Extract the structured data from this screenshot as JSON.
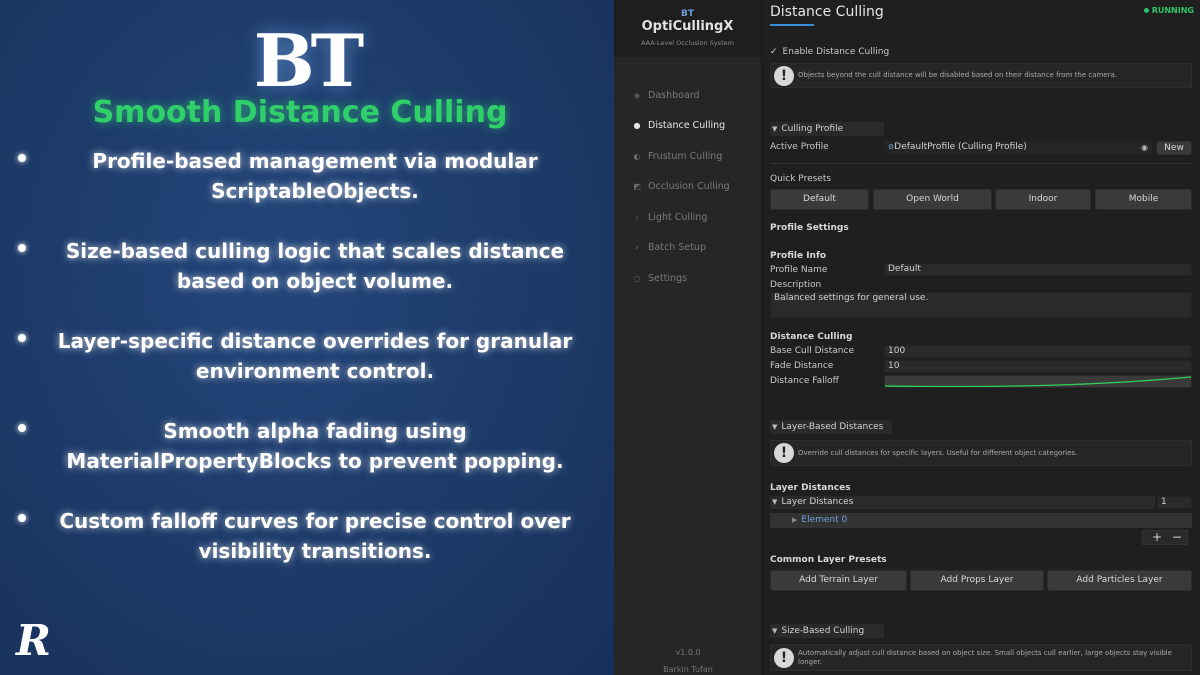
{
  "promo": {
    "logo_text": "BT",
    "title": "Smooth Distance Culling",
    "bullets": [
      "Profile-based management via modular ScriptableObjects.",
      "Size-based culling logic that scales distance based on object volume.",
      "Layer-specific distance overrides for granular environment control.",
      "Smooth alpha fading using MaterialPropertyBlocks to prevent popping.",
      "Custom falloff curves for precise control over visibility transitions."
    ],
    "corner_logo": "R"
  },
  "sidebar": {
    "brand_small": "BT",
    "brand_name": "OptiCullingX",
    "brand_sub": "AAA-Level Occlusion System",
    "items": [
      {
        "label": "Dashboard",
        "icon": "diamond-icon"
      },
      {
        "label": "Distance Culling",
        "icon": "circle-icon"
      },
      {
        "label": "Frustum Culling",
        "icon": "half-circle-icon"
      },
      {
        "label": "Occlusion Culling",
        "icon": "wedge-icon"
      },
      {
        "label": "Light Culling",
        "icon": "chevron-icon"
      },
      {
        "label": "Batch Setup",
        "icon": "chevron-icon"
      },
      {
        "label": "Settings",
        "icon": "gear-icon"
      }
    ],
    "active_index": 1,
    "version": "v1.0.0",
    "author": "Barkin Tufan"
  },
  "main": {
    "title": "Distance Culling",
    "status": "RUNNING",
    "enable_label": "Enable Distance Culling",
    "enable_checked": true,
    "enable_help": "Objects beyond the cull distance will be disabled based on their distance from the camera.",
    "culling_profile_header": "Culling Profile",
    "active_profile_label": "Active Profile",
    "active_profile_value": "DefaultProfile (Culling Profile)",
    "new_button": "New",
    "quick_presets_label": "Quick Presets",
    "presets": [
      "Default",
      "Open World",
      "Indoor",
      "Mobile"
    ],
    "profile_settings_label": "Profile Settings",
    "profile_info_label": "Profile Info",
    "profile_name_label": "Profile Name",
    "profile_name_value": "Default",
    "description_label": "Description",
    "description_value": "Balanced settings for general use.",
    "distance_culling_label": "Distance Culling",
    "base_cull_label": "Base Cull Distance",
    "base_cull_value": "100",
    "fade_label": "Fade Distance",
    "fade_value": "10",
    "falloff_label": "Distance Falloff",
    "layer_header": "Layer-Based Distances",
    "layer_help": "Override cull distances for specific layers. Useful for different object categories.",
    "layer_distances_label": "Layer Distances",
    "layer_distances_foldout": "Layer Distances",
    "layer_count": "1",
    "element_label": "Element 0",
    "plus": "+",
    "minus": "−",
    "common_presets_label": "Common Layer Presets",
    "layer_buttons": [
      "Add Terrain Layer",
      "Add Props Layer",
      "Add Particles Layer"
    ],
    "size_header": "Size-Based Culling",
    "size_help": "Automatically adjust cull distance based on object size. Small objects cull earlier, large objects stay visible longer."
  },
  "colors": {
    "promo_bg": "#1c3a68",
    "promo_title": "#2fd06a",
    "accent_blue": "#3b8ed9",
    "status_green": "#2fc56a",
    "curve_green": "#2fd05a"
  }
}
